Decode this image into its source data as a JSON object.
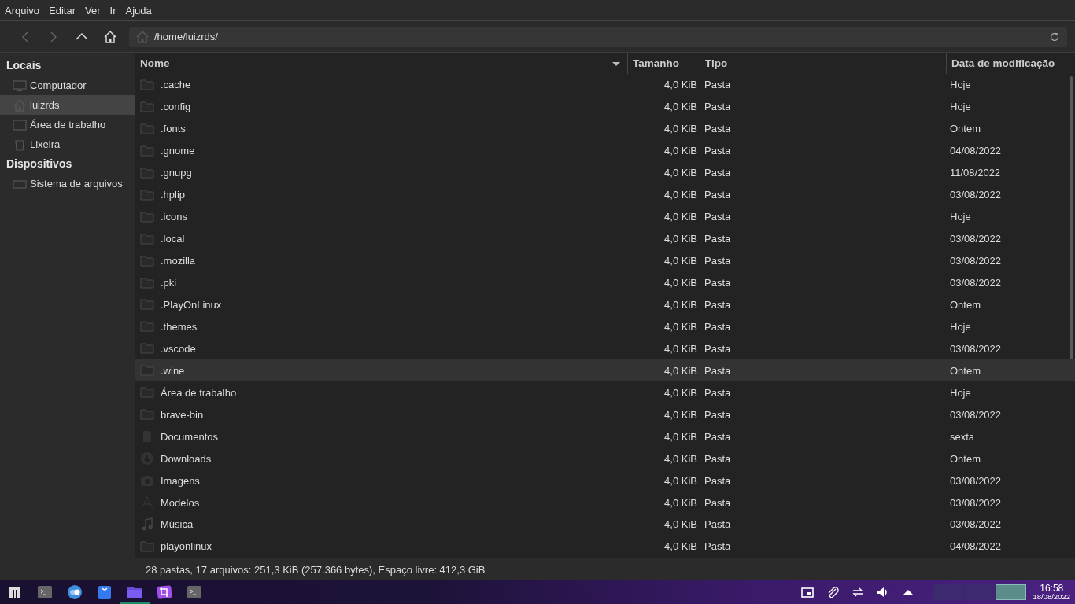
{
  "menu": [
    "Arquivo",
    "Editar",
    "Ver",
    "Ir",
    "Ajuda"
  ],
  "location": {
    "path": "/home/luizrds/"
  },
  "sidebar": [
    {
      "heading": "Locais",
      "items": [
        {
          "label": "Computador",
          "kind": "computer",
          "selected": false
        },
        {
          "label": "luizrds",
          "kind": "home",
          "selected": true
        },
        {
          "label": "Área de trabalho",
          "kind": "desktop",
          "selected": false
        },
        {
          "label": "Lixeira",
          "kind": "trash",
          "selected": false
        }
      ]
    },
    {
      "heading": "Dispositivos",
      "items": [
        {
          "label": "Sistema de arquivos",
          "kind": "drive",
          "selected": false
        }
      ]
    }
  ],
  "table": {
    "columns": [
      "Nome",
      "Tamanho",
      "Tipo",
      "Data de modificação"
    ],
    "rows": [
      {
        "kind": "folder",
        "name": ".cache",
        "size": "4,0 KiB",
        "type": "Pasta",
        "modified": "Hoje",
        "selected": false
      },
      {
        "kind": "folder",
        "name": ".config",
        "size": "4,0 KiB",
        "type": "Pasta",
        "modified": "Hoje",
        "selected": false
      },
      {
        "kind": "folder",
        "name": ".fonts",
        "size": "4,0 KiB",
        "type": "Pasta",
        "modified": "Ontem",
        "selected": false
      },
      {
        "kind": "folder",
        "name": ".gnome",
        "size": "4,0 KiB",
        "type": "Pasta",
        "modified": "04/08/2022",
        "selected": false
      },
      {
        "kind": "folder",
        "name": ".gnupg",
        "size": "4,0 KiB",
        "type": "Pasta",
        "modified": "11/08/2022",
        "selected": false
      },
      {
        "kind": "folder",
        "name": ".hplip",
        "size": "4,0 KiB",
        "type": "Pasta",
        "modified": "03/08/2022",
        "selected": false
      },
      {
        "kind": "folder",
        "name": ".icons",
        "size": "4,0 KiB",
        "type": "Pasta",
        "modified": "Hoje",
        "selected": false
      },
      {
        "kind": "folder",
        "name": ".local",
        "size": "4,0 KiB",
        "type": "Pasta",
        "modified": "03/08/2022",
        "selected": false
      },
      {
        "kind": "folder",
        "name": ".mozilla",
        "size": "4,0 KiB",
        "type": "Pasta",
        "modified": "03/08/2022",
        "selected": false
      },
      {
        "kind": "folder",
        "name": ".pki",
        "size": "4,0 KiB",
        "type": "Pasta",
        "modified": "03/08/2022",
        "selected": false
      },
      {
        "kind": "folder",
        "name": ".PlayOnLinux",
        "size": "4,0 KiB",
        "type": "Pasta",
        "modified": "Ontem",
        "selected": false
      },
      {
        "kind": "folder",
        "name": ".themes",
        "size": "4,0 KiB",
        "type": "Pasta",
        "modified": "Hoje",
        "selected": false
      },
      {
        "kind": "folder",
        "name": ".vscode",
        "size": "4,0 KiB",
        "type": "Pasta",
        "modified": "03/08/2022",
        "selected": false
      },
      {
        "kind": "folder",
        "name": ".wine",
        "size": "4,0 KiB",
        "type": "Pasta",
        "modified": "Ontem",
        "selected": true
      },
      {
        "kind": "folder",
        "name": "Área de trabalho",
        "size": "4,0 KiB",
        "type": "Pasta",
        "modified": "Hoje",
        "selected": false
      },
      {
        "kind": "folder",
        "name": "brave-bin",
        "size": "4,0 KiB",
        "type": "Pasta",
        "modified": "03/08/2022",
        "selected": false
      },
      {
        "kind": "documents",
        "name": "Documentos",
        "size": "4,0 KiB",
        "type": "Pasta",
        "modified": "sexta",
        "selected": false
      },
      {
        "kind": "downloads",
        "name": "Downloads",
        "size": "4,0 KiB",
        "type": "Pasta",
        "modified": "Ontem",
        "selected": false
      },
      {
        "kind": "pictures",
        "name": "Imagens",
        "size": "4,0 KiB",
        "type": "Pasta",
        "modified": "03/08/2022",
        "selected": false
      },
      {
        "kind": "templates",
        "name": "Modelos",
        "size": "4,0 KiB",
        "type": "Pasta",
        "modified": "03/08/2022",
        "selected": false
      },
      {
        "kind": "music",
        "name": "Música",
        "size": "4,0 KiB",
        "type": "Pasta",
        "modified": "03/08/2022",
        "selected": false
      },
      {
        "kind": "folder",
        "name": "playonlinux",
        "size": "4,0 KiB",
        "type": "Pasta",
        "modified": "04/08/2022",
        "selected": false
      }
    ]
  },
  "status_bar": "28 pastas, 17 arquivos: 251,3 KiB (257.366 bytes), Espaço livre: 412,3 GiB",
  "taskbar": {
    "apps": [
      {
        "kind": "terminal",
        "selected": false
      },
      {
        "kind": "toggle",
        "selected": false
      },
      {
        "kind": "store",
        "selected": false
      },
      {
        "kind": "files",
        "selected": true
      },
      {
        "kind": "screenshot",
        "selected": false
      },
      {
        "kind": "terminal",
        "selected": false
      }
    ],
    "tray": [
      {
        "kind": "window"
      },
      {
        "kind": "clip"
      },
      {
        "kind": "network"
      },
      {
        "kind": "volume"
      },
      {
        "kind": "up"
      }
    ],
    "workspaces": [
      {
        "selected": false
      },
      {
        "selected": false
      },
      {
        "selected": true
      }
    ],
    "time": "16:58",
    "date": "18/08/2022"
  }
}
